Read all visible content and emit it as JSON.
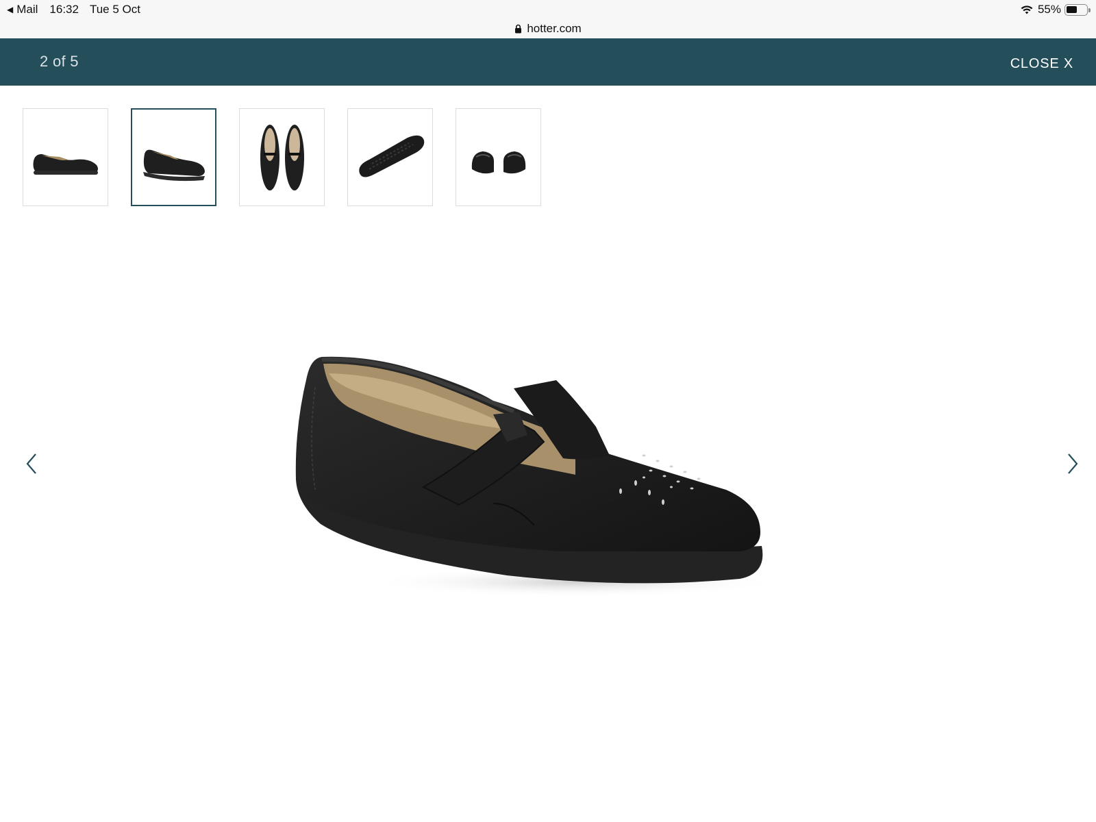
{
  "status_bar": {
    "back_app": "Mail",
    "time": "16:32",
    "date": "Tue 5 Oct",
    "battery_percent": "55%",
    "battery_level": 0.55,
    "icons": [
      "back-arrow-icon",
      "wifi-icon",
      "battery-icon"
    ]
  },
  "url_bar": {
    "domain": "hotter.com",
    "icon": "lock-icon"
  },
  "gallery": {
    "counter": "2 of 5",
    "close_label": "CLOSE X",
    "current_index": 2,
    "total": 5,
    "thumbnails": [
      {
        "view": "side",
        "active": false
      },
      {
        "view": "angled-side",
        "active": true
      },
      {
        "view": "top-pair",
        "active": false
      },
      {
        "view": "sole",
        "active": false
      },
      {
        "view": "back-pair",
        "active": false
      }
    ],
    "prev_icon": "chevron-left-icon",
    "next_icon": "chevron-right-icon"
  },
  "colors": {
    "header_bg": "#234e5a",
    "active_thumb_border": "#234e5a",
    "arrow": "#234e5a"
  }
}
